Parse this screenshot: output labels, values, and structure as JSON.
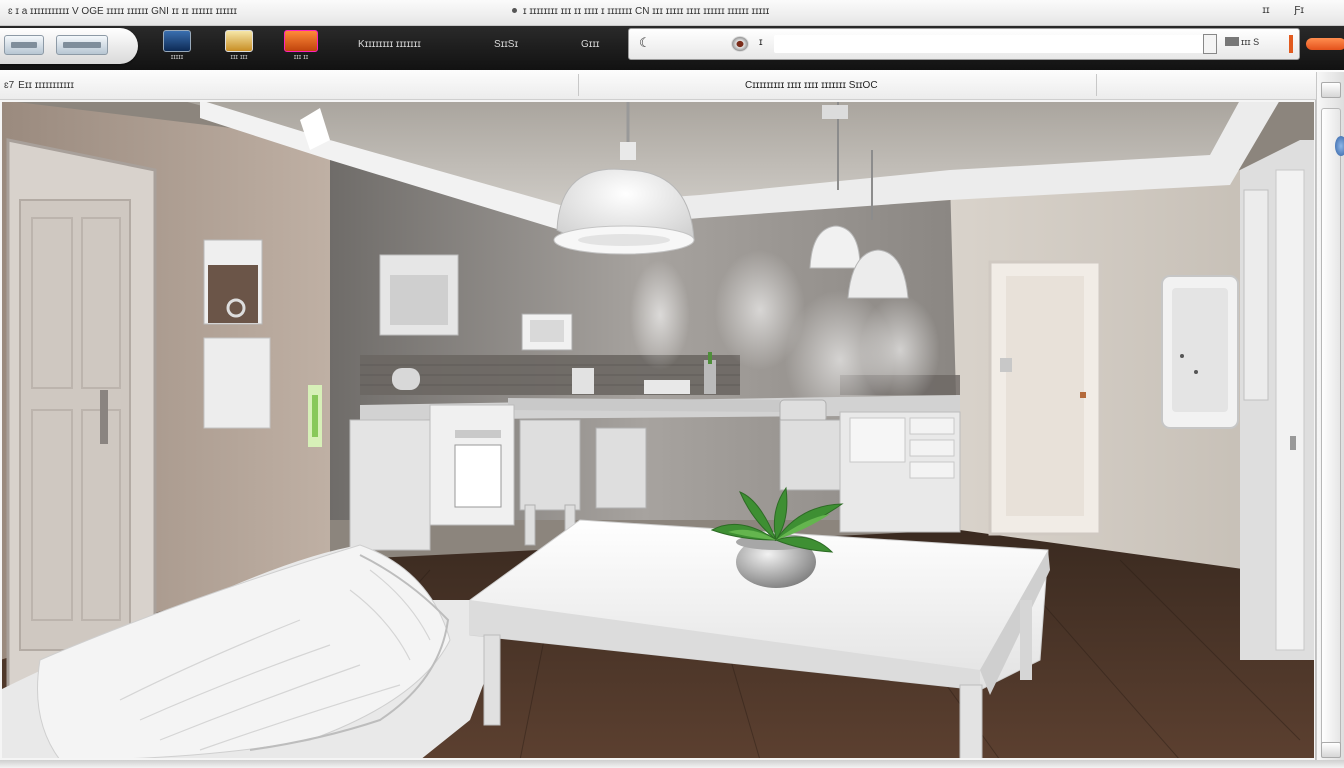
{
  "titlebar": {
    "left_text": "ɛ ɪ a ɪɪɪɪɪɪɪɪɪɪɪ V OGE ɪɪɪɪɪ ɪɪɪɪɪɪ GNI ɪɪ ɪɪ ɪɪɪɪɪɪ ɪɪɪɪɪɪ",
    "center_text": "ɪ ɪɪɪɪɪɪɪɪ ɪɪɪ ɪɪ ɪɪɪɪ ɪ ɪɪɪɪɪɪɪ CN ɪɪɪ ɪɪɪɪɪ ɪɪɪɪ ɪɪɪɪɪɪ ɪɪɪɪɪɪ ɪɪɪɪɪ",
    "right_items": [
      "ɪɪ",
      "Ƒɪ"
    ]
  },
  "toolbar": {
    "apps": [
      {
        "label": "ɪɪɪɪɪ",
        "icon": "monitor-icon"
      },
      {
        "label": "ɪɪɪ ɪɪɪ",
        "icon": "sun-icon"
      },
      {
        "label": "ɪɪɪ ɪɪ",
        "icon": "tv-icon"
      }
    ],
    "menu_title": "Kɪɪɪɪɪɪɪɪ ɪɪɪɪɪɪɪ",
    "menu_item_2": "SɪɪSɪ",
    "menu_item_3": "Gɪɪɪ",
    "search": {
      "query_prefix": "ɪ",
      "value": "",
      "controls_label": "ɪɪɪ S"
    }
  },
  "subbar": {
    "crumb_prefix": "ɛ7",
    "crumb_text": "Eɪɪ ɪɪɪɪɪɪɪɪɪɪɪ",
    "caption": "Cɪɪɪɪɪɪɪɪɪ ɪɪɪɪ ɪɪɪɪ ɪɪɪɪɪɪɪ SɪɪOC"
  },
  "colors": {
    "toolbar_bg": "#1a1a1a",
    "accent_orange": "#e4521c",
    "floor": "#4a3326",
    "wall_left": "#8e7f73",
    "ceiling": "#bdb9b3"
  }
}
